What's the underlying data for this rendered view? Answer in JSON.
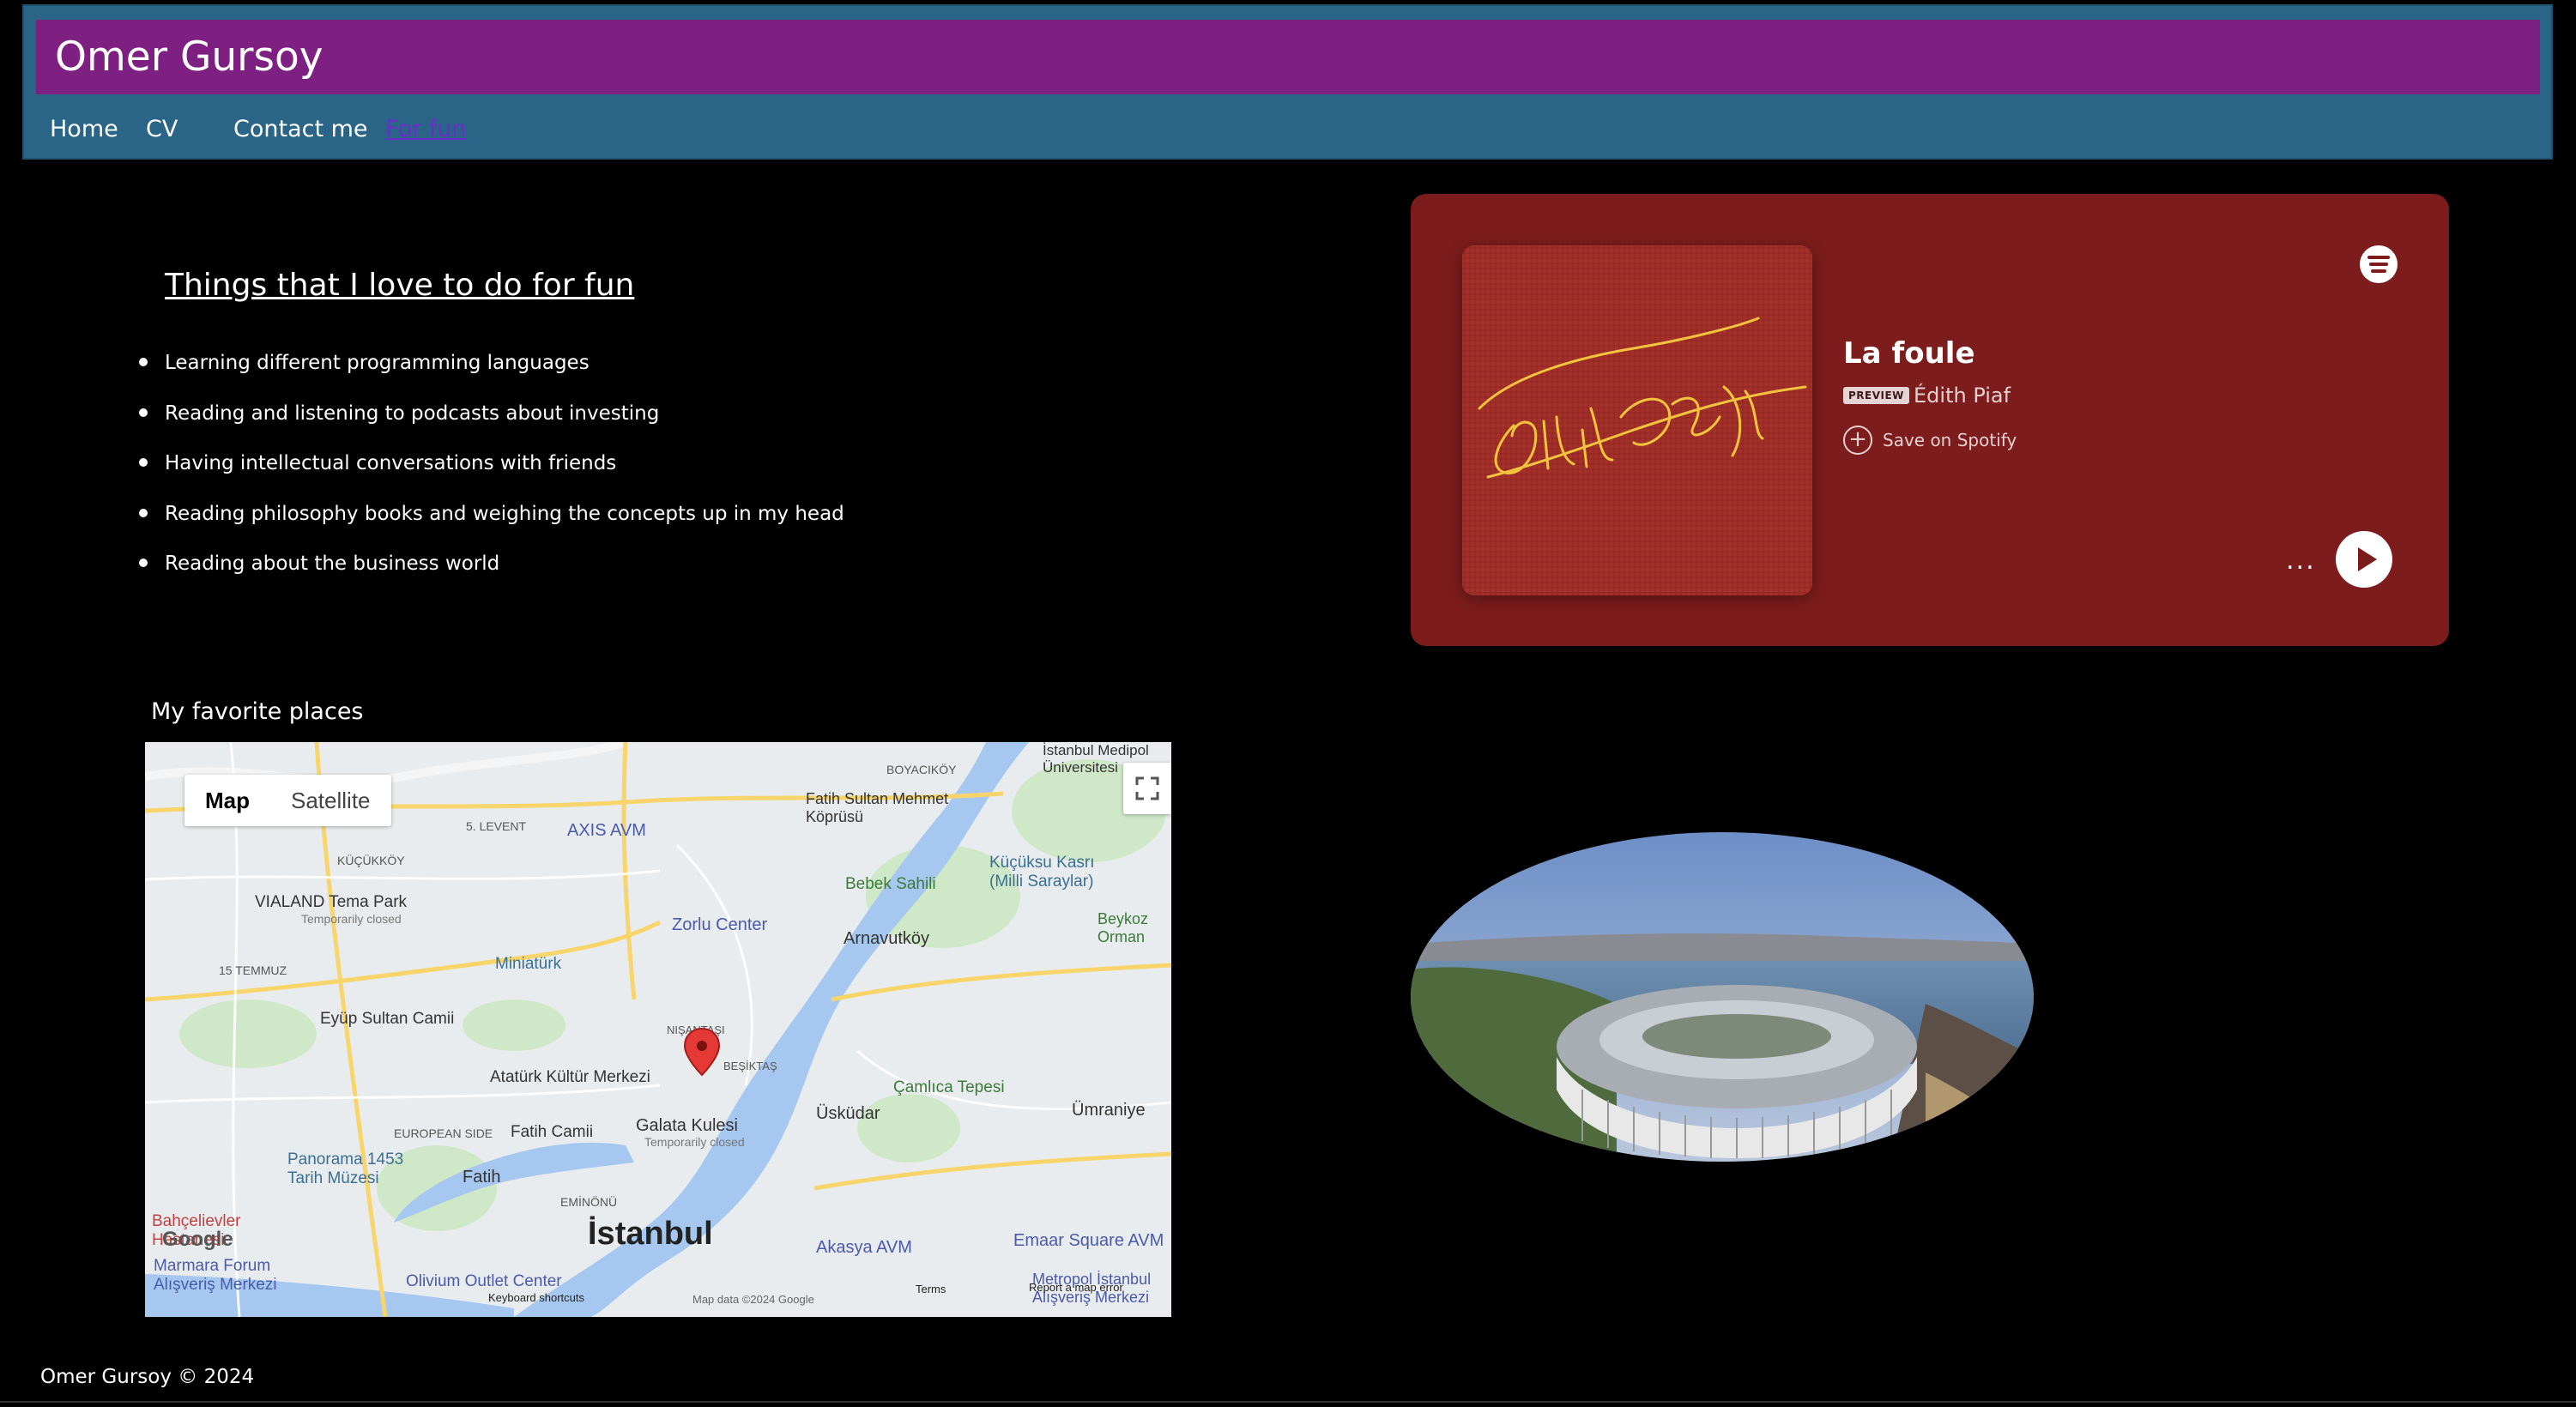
{
  "site": {
    "title": "Omer Gursoy"
  },
  "nav": {
    "items": [
      "Home",
      "CV",
      "Contact me",
      "For fun"
    ],
    "active": "For fun"
  },
  "fun": {
    "heading": "Things that I love to do for fun",
    "items": [
      "Learning different programming languages",
      "Reading and listening to podcasts about investing",
      "Having intellectual conversations with friends",
      "Reading philosophy books and weighing the concepts up in my head",
      "Reading about the business world"
    ]
  },
  "spotify": {
    "track": "La foule",
    "badge": "PREVIEW",
    "artist": "Édith Piaf",
    "save_label": "Save on Spotify",
    "more_label": "...",
    "album_icon": "album-cover-signature",
    "accent": "#7c1c1c"
  },
  "places": {
    "heading": "My favorite places",
    "map": {
      "toggle_map": "Map",
      "toggle_satellite": "Satellite",
      "labels": {
        "istanbul": "İstanbul",
        "uskudar": "Üsküdar",
        "besiktas": "BEŞİKTAŞ",
        "nisantasi": "NIŞANTAŞI",
        "arnavutkoy": "Arnavutköy",
        "bebek": "Bebek Sahili",
        "zorlu": "Zorlu Center",
        "axis": "AXIS AVM",
        "galata": "Galata Kulesi",
        "galata_sub": "Temporarily closed",
        "akm": "Atatürk Kültür Merkezi",
        "fatih_camii": "Fatih Camii",
        "fatih": "Fatih",
        "eminonu": "EMİNÖNÜ",
        "camlica": "Çamlıca Tepesi",
        "umraniye": "Ümraniye",
        "akasya": "Akasya AVM",
        "emaar": "Emaar Square AVM",
        "miniaturk": "Miniatürk",
        "eyup": "Eyüp Sultan Camii",
        "vialand": "VIALAND Tema Park",
        "vialand_sub": "Temporarily closed",
        "panorama": "Panorama 1453 Tarih Müzesi",
        "marmara": "Marmara Forum Alışveriş Merkezi",
        "olivium": "Olivium Outlet Center",
        "bahcelievler": "Bahçelievler Hastanesi",
        "kucukyali": "Küçüksu Kasrı (Milli Saraylar)",
        "fsm": "Fatih Sultan Mehmet Köprüsü",
        "levent": "5. LEVENT",
        "kucukkoy": "KÜÇÜKKÖY",
        "temmuz": "15 TEMMUZ",
        "european": "EUROPEAN SIDE",
        "medipol": "İstanbul Medipol Üniversitesi",
        "boyacikoy": "BOYACIKÖY",
        "beykoz": "Beykoz Orman",
        "metropol": "Metropol İstanbul Alışveriş Merkezi"
      },
      "footer": {
        "shortcuts": "Keyboard shortcuts",
        "data": "Map data ©2024 Google",
        "terms": "Terms",
        "report": "Report a map error",
        "google": "Google"
      },
      "water": "#a6c8f0",
      "land": "#e9ecee"
    }
  },
  "photo": {
    "subject": "stadium-aerial-photo"
  },
  "footer": {
    "text": "Omer Gursoy © 2024"
  },
  "colors": {
    "header": "#2a6587",
    "title_bar": "#7e1f82",
    "nav_active": "#6a2ecb",
    "spotify_bg": "#7c1c1c"
  }
}
